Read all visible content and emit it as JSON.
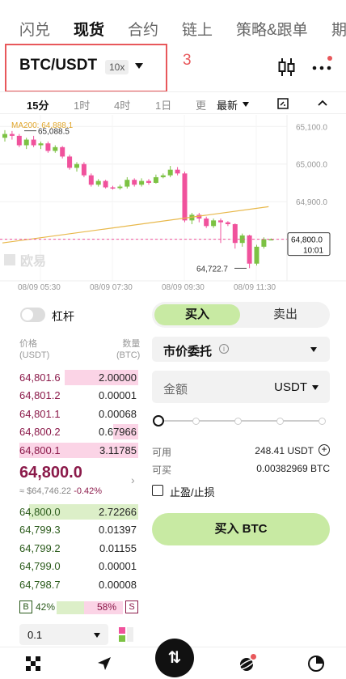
{
  "nav_tabs": [
    "闪兑",
    "现货",
    "合约",
    "链上",
    "策略&跟单",
    "期"
  ],
  "pair": "BTC/USDT",
  "leverage_badge": "10x",
  "annotation": "3",
  "timeframes": [
    "15分",
    "1时",
    "4时",
    "1日",
    "更",
    "最新"
  ],
  "chart": {
    "ma_label": "MA200: 64,888.1",
    "high_label": "65,088.5",
    "low_label": "64,722.7",
    "watermark": "欧易",
    "y_ticks": [
      "65,100.0",
      "65,000.0",
      "64,900.0",
      "64,800.0"
    ],
    "x_ticks": [
      "08/09 05:30",
      "08/09 07:30",
      "08/09 09:30",
      "08/09 11:30"
    ],
    "price_tag": "64,800.0",
    "countdown": "10:01",
    "ylim": [
      64700,
      65120
    ],
    "candles": [
      {
        "o": 65070,
        "c": 65080,
        "h": 65090,
        "l": 65060
      },
      {
        "o": 65080,
        "c": 65075,
        "h": 65088,
        "l": 65065
      },
      {
        "o": 65075,
        "c": 65050,
        "h": 65080,
        "l": 65045
      },
      {
        "o": 65050,
        "c": 65065,
        "h": 65070,
        "l": 65040
      },
      {
        "o": 65065,
        "c": 65050,
        "h": 65075,
        "l": 65045
      },
      {
        "o": 65050,
        "c": 65055,
        "h": 65060,
        "l": 65040
      },
      {
        "o": 65055,
        "c": 65035,
        "h": 65060,
        "l": 65030
      },
      {
        "o": 65035,
        "c": 65045,
        "h": 65050,
        "l": 65030
      },
      {
        "o": 65045,
        "c": 65020,
        "h": 65048,
        "l": 65015
      },
      {
        "o": 65020,
        "c": 64990,
        "h": 65025,
        "l": 64985
      },
      {
        "o": 64990,
        "c": 65000,
        "h": 65005,
        "l": 64980
      },
      {
        "o": 65000,
        "c": 64970,
        "h": 65005,
        "l": 64965
      },
      {
        "o": 64970,
        "c": 64945,
        "h": 64975,
        "l": 64940
      },
      {
        "o": 64945,
        "c": 64955,
        "h": 64960,
        "l": 64940
      },
      {
        "o": 64955,
        "c": 64938,
        "h": 64958,
        "l": 64935
      },
      {
        "o": 64938,
        "c": 64936,
        "h": 64942,
        "l": 64932
      },
      {
        "o": 64936,
        "c": 64940,
        "h": 64945,
        "l": 64932
      },
      {
        "o": 64940,
        "c": 64958,
        "h": 64965,
        "l": 64935
      },
      {
        "o": 64958,
        "c": 64945,
        "h": 64962,
        "l": 64940
      },
      {
        "o": 64945,
        "c": 64955,
        "h": 64962,
        "l": 64940
      },
      {
        "o": 64955,
        "c": 64950,
        "h": 64960,
        "l": 64945
      },
      {
        "o": 64950,
        "c": 64965,
        "h": 64972,
        "l": 64948
      },
      {
        "o": 64965,
        "c": 64970,
        "h": 64975,
        "l": 64962
      },
      {
        "o": 64970,
        "c": 64985,
        "h": 64995,
        "l": 64965
      },
      {
        "o": 64985,
        "c": 64975,
        "h": 64992,
        "l": 64970
      },
      {
        "o": 64975,
        "c": 64850,
        "h": 64980,
        "l": 64845
      },
      {
        "o": 64850,
        "c": 64865,
        "h": 64870,
        "l": 64840
      },
      {
        "o": 64865,
        "c": 64855,
        "h": 64870,
        "l": 64845
      },
      {
        "o": 64855,
        "c": 64835,
        "h": 64860,
        "l": 64830
      },
      {
        "o": 64835,
        "c": 64850,
        "h": 64855,
        "l": 64830
      },
      {
        "o": 64850,
        "c": 64845,
        "h": 64855,
        "l": 64790
      },
      {
        "o": 64845,
        "c": 64840,
        "h": 64848,
        "l": 64835
      },
      {
        "o": 64840,
        "c": 64790,
        "h": 64842,
        "l": 64775
      },
      {
        "o": 64790,
        "c": 64810,
        "h": 64815,
        "l": 64780
      },
      {
        "o": 64810,
        "c": 64735,
        "h": 64812,
        "l": 64723
      },
      {
        "o": 64735,
        "c": 64780,
        "h": 64785,
        "l": 64730
      },
      {
        "o": 64780,
        "c": 64800,
        "h": 64805,
        "l": 64775
      },
      {
        "o": 64800,
        "c": 64800,
        "h": 64802,
        "l": 64798
      }
    ],
    "ma_line": [
      [
        0,
        64790
      ],
      [
        37,
        64865
      ]
    ]
  },
  "leverage_toggle_label": "杠杆",
  "orderbook": {
    "price_header": [
      "价格",
      "(USDT)"
    ],
    "qty_header": [
      "数量",
      "(BTC)"
    ],
    "asks": [
      {
        "price": "64,801.6",
        "qty": "2.00000",
        "depth": 0.62
      },
      {
        "price": "64,801.2",
        "qty": "0.00001",
        "depth": 0.0
      },
      {
        "price": "64,801.1",
        "qty": "0.00068",
        "depth": 0.0
      },
      {
        "price": "64,800.2",
        "qty": "0.67966",
        "depth": 0.21
      },
      {
        "price": "64,800.1",
        "qty": "3.11785",
        "depth": 1.0
      }
    ],
    "last_price": "64,800.0",
    "mark_price": "≈ $64,746.22",
    "change_pct": "-0.42%",
    "bids": [
      {
        "price": "64,800.0",
        "qty": "2.72266",
        "depth": 0.92
      },
      {
        "price": "64,799.3",
        "qty": "0.01397",
        "depth": 0.0
      },
      {
        "price": "64,799.2",
        "qty": "0.01155",
        "depth": 0.0
      },
      {
        "price": "64,799.0",
        "qty": "0.00001",
        "depth": 0.0
      },
      {
        "price": "64,798.7",
        "qty": "0.00008",
        "depth": 0.0
      }
    ],
    "buy_ratio": "42%",
    "sell_ratio": "58%",
    "buy_ratio_fraction": 0.42,
    "b_label": "B",
    "s_label": "S",
    "precision": "0.1"
  },
  "order_form": {
    "buy_tab": "买入",
    "sell_tab": "卖出",
    "order_type": "市价委托",
    "amount_label": "金额",
    "amount_unit": "USDT",
    "slider_percent": 0,
    "available_label": "可用",
    "available_value": "248.41 USDT",
    "can_buy_label": "可买",
    "can_buy_value": "0.00382969 BTC",
    "tpsl_label": "止盈/止损",
    "submit_label": "买入 BTC"
  },
  "colors": {
    "up": "#7cc243",
    "down": "#f0529c",
    "buy_accent": "#c8eaa3",
    "annotation": "#e8585b"
  },
  "bottom_nav_icons": [
    "grid-icon",
    "compass-icon",
    "trade-icon",
    "planet-icon",
    "pie-chart-icon"
  ]
}
